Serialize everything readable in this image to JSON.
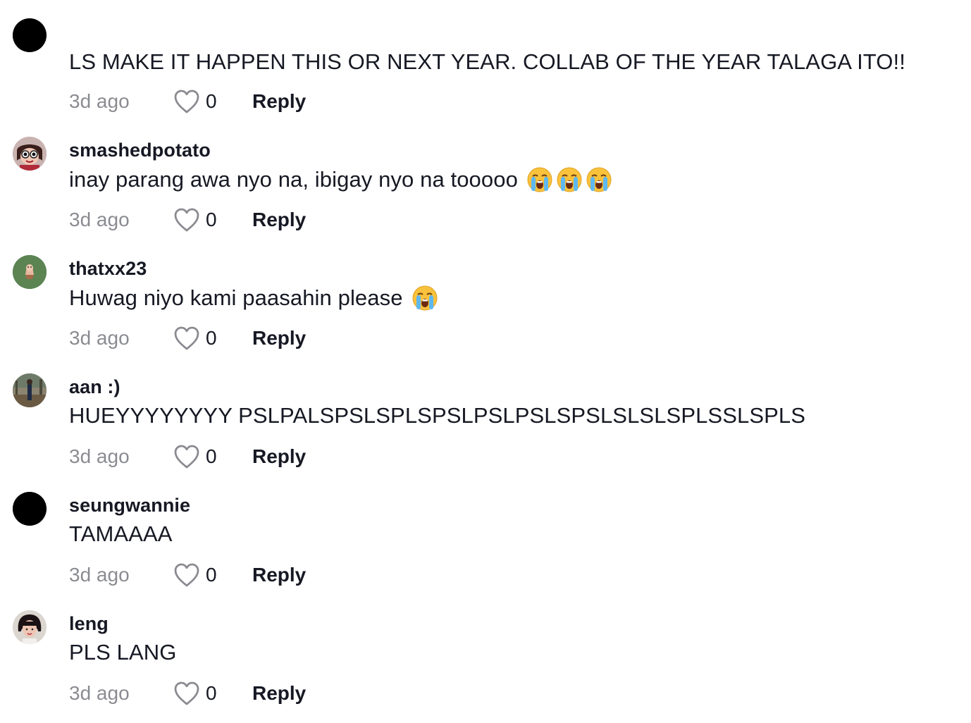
{
  "comments": [
    {
      "avatar": "black-circle",
      "username": "",
      "text": "LS MAKE IT HAPPEN THIS OR NEXT YEAR. COLLAB OF THE YEAR TALAGA ITO!!",
      "emoji_count": 0,
      "time": "3d ago",
      "likes": "0",
      "reply": "Reply"
    },
    {
      "avatar": "cartoon-girl-avatar",
      "username": "smashedpotato",
      "text": "inay parang awa nyo na, ibigay nyo na tooooo",
      "emoji_count": 3,
      "emoji": "loudly-crying-face",
      "time": "3d ago",
      "likes": "0",
      "reply": "Reply"
    },
    {
      "avatar": "green-character-avatar",
      "username": "thatxx23",
      "text": "Huwag niyo kami paasahin please",
      "emoji_count": 1,
      "emoji": "loudly-crying-face",
      "time": "3d ago",
      "likes": "0",
      "reply": "Reply"
    },
    {
      "avatar": "outdoor-photo-avatar",
      "username": "aan :)",
      "text": "HUEYYYYYYYY PSLPALSPSLSPLSPSLPSLPSLSPSLSLSLSPLSSLSPLS",
      "emoji_count": 0,
      "time": "3d ago",
      "likes": "0",
      "reply": "Reply"
    },
    {
      "avatar": "black-circle",
      "username": "seungwannie",
      "text": "TAMAAAA",
      "emoji_count": 0,
      "time": "3d ago",
      "likes": "0",
      "reply": "Reply"
    },
    {
      "avatar": "portrait-photo-avatar",
      "username": "leng",
      "text": "PLS LANG",
      "emoji_count": 0,
      "time": "3d ago",
      "likes": "0",
      "reply": "Reply"
    }
  ],
  "colors": {
    "text": "#161823",
    "muted": "#8a8b91",
    "background": "#ffffff"
  },
  "icons": {
    "like": "heart-outline-icon",
    "emoji": "loudly-crying-face"
  }
}
